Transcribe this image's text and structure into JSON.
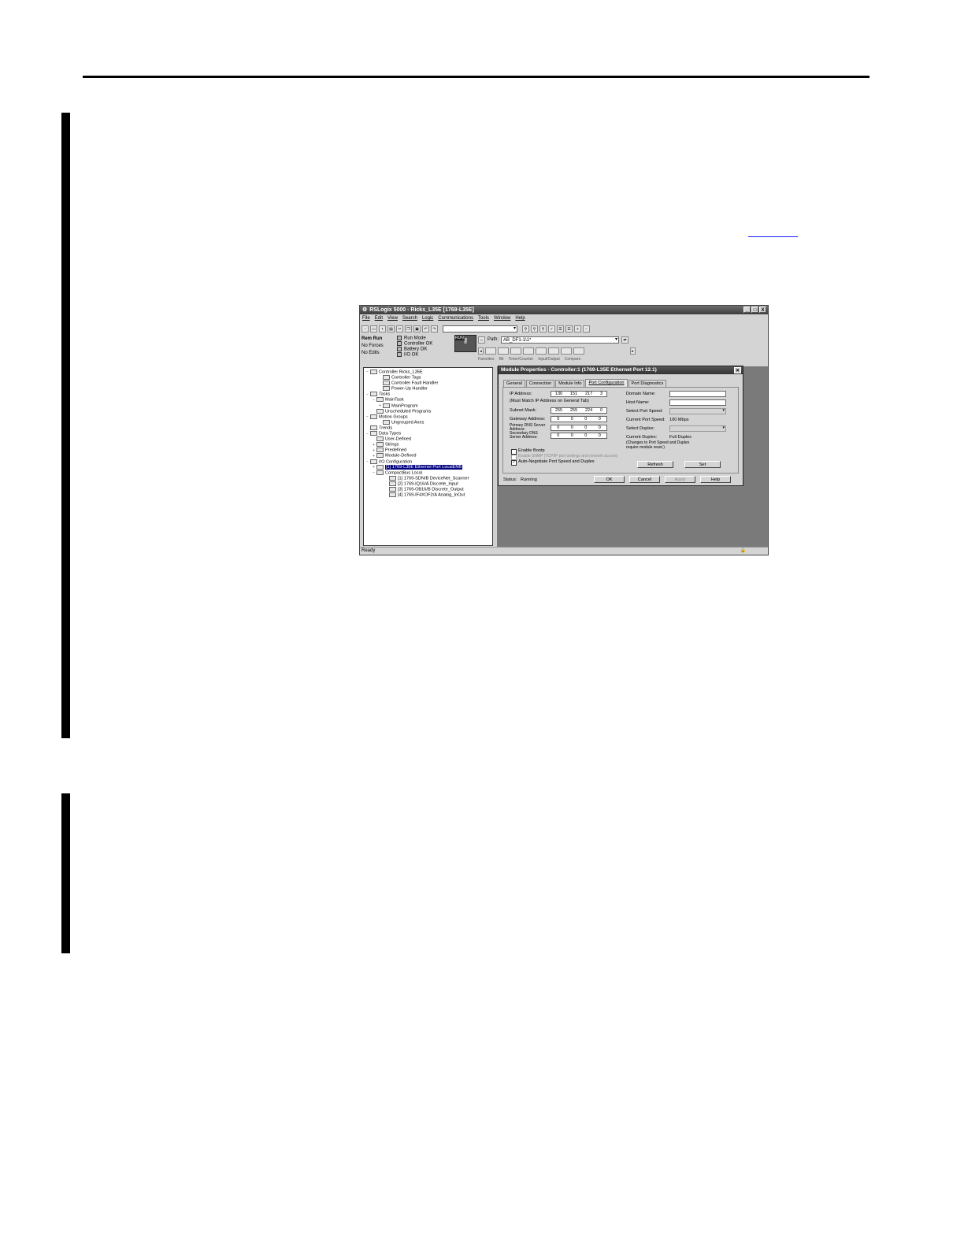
{
  "app": {
    "title": "RSLogix 5000 - Ricks_L35E [1769-L35E]",
    "menu": [
      "File",
      "Edit",
      "View",
      "Search",
      "Logic",
      "Communications",
      "Tools",
      "Window",
      "Help"
    ],
    "window_buttons": [
      "_",
      "□",
      "X"
    ],
    "status": {
      "run": "Rem Run",
      "forces": "No Forces",
      "edits": "No Edits"
    },
    "modes": [
      "Run Mode",
      "Controller OK",
      "Battery OK",
      "I/O OK"
    ],
    "keyswitch": "RUN",
    "path_label": "Path:",
    "path_value": "AB_DF1-1\\1*",
    "ladder_tabs": [
      "Favorites",
      "Bit",
      "Timer/Counter",
      "Input/Output",
      "Compare"
    ],
    "statusbar": "Ready"
  },
  "tree": [
    {
      "glyph": "−",
      "indent": 0,
      "label": "Controller Ricks_L35E"
    },
    {
      "glyph": "",
      "indent": 2,
      "label": "Controller Tags"
    },
    {
      "glyph": "",
      "indent": 2,
      "label": "Controller Fault Handler"
    },
    {
      "glyph": "",
      "indent": 2,
      "label": "Power-Up Handler"
    },
    {
      "glyph": "−",
      "indent": 0,
      "label": "Tasks"
    },
    {
      "glyph": "−",
      "indent": 1,
      "label": "MainTask"
    },
    {
      "glyph": "+",
      "indent": 2,
      "label": "MainProgram"
    },
    {
      "glyph": "",
      "indent": 1,
      "label": "Unscheduled Programs"
    },
    {
      "glyph": "−",
      "indent": 0,
      "label": "Motion Groups"
    },
    {
      "glyph": "",
      "indent": 2,
      "label": "Ungrouped Axes"
    },
    {
      "glyph": "",
      "indent": 0,
      "label": "Trends"
    },
    {
      "glyph": "−",
      "indent": 0,
      "label": "Data Types"
    },
    {
      "glyph": "",
      "indent": 1,
      "label": "User-Defined"
    },
    {
      "glyph": "+",
      "indent": 1,
      "label": "Strings"
    },
    {
      "glyph": "+",
      "indent": 1,
      "label": "Predefined"
    },
    {
      "glyph": "+",
      "indent": 1,
      "label": "Module-Defined"
    },
    {
      "glyph": "−",
      "indent": 0,
      "label": "I/O Configuration"
    },
    {
      "glyph": "+",
      "indent": 1,
      "label": "[1] 1769-L35E Ethernet Port LocalENB",
      "selected": true
    },
    {
      "glyph": "−",
      "indent": 1,
      "label": "CompactBus Local"
    },
    {
      "glyph": "",
      "indent": 3,
      "label": "[1] 1769-SDN/B DeviceNet_Scanner"
    },
    {
      "glyph": "",
      "indent": 3,
      "label": "[2] 1769-IQ16/A Discrete_Input"
    },
    {
      "glyph": "",
      "indent": 3,
      "label": "[3] 1769-OB16/B Discrete_Output"
    },
    {
      "glyph": "",
      "indent": 3,
      "label": "[4] 1769-IF4XOF2/A Analog_InOut"
    }
  ],
  "dialog": {
    "title": "Module Properties - Controller:1 (1769-L35E Ethernet Port 12.1)",
    "tabs": [
      "General",
      "Connection",
      "Module Info",
      "Port Configuration",
      "Port Diagnostics"
    ],
    "ip_label": "IP Address:",
    "ip_value": [
      "130",
      "151",
      "217",
      "3"
    ],
    "must_match": "(Must Match IP Address on General Tab)",
    "subnet_label": "Subnet Mask:",
    "subnet_value": [
      "255",
      "255",
      "224",
      "0"
    ],
    "gateway_label": "Gateway Address:",
    "gateway_value": [
      "0",
      "0",
      "0",
      "0"
    ],
    "primary_dns_label": "Primary DNS Server Address:",
    "primary_dns_value": [
      "0",
      "0",
      "0",
      "0"
    ],
    "secondary_dns_label": "Secondary DNS Server Address:",
    "secondary_dns_value": [
      "0",
      "0",
      "0",
      "0"
    ],
    "domain_label": "Domain Name:",
    "host_label": "Host Name:",
    "select_speed_label": "Select Port Speed:",
    "current_speed_label": "Current Port Speed:",
    "current_speed_value": "100 Mbps",
    "select_duplex_label": "Select Duplex:",
    "current_duplex_label": "Current Duplex:",
    "current_duplex_value": "Full Duplex",
    "change_note": "(Changes to Port Speed and Duplex require module reset.)",
    "enable_bootp": "Enable Bootp",
    "disabled_option": "Enable SNMP (TCP/IP port settings and network access)",
    "auto_negotiate": "Auto-Negotiate Port Speed and Duplex",
    "refresh_button": "Refresh",
    "set_button": "Set",
    "status_label": "Status:",
    "status_value": "Running",
    "ok_button": "OK",
    "cancel_button": "Cancel",
    "apply_button": "Apply",
    "help_button": "Help"
  }
}
